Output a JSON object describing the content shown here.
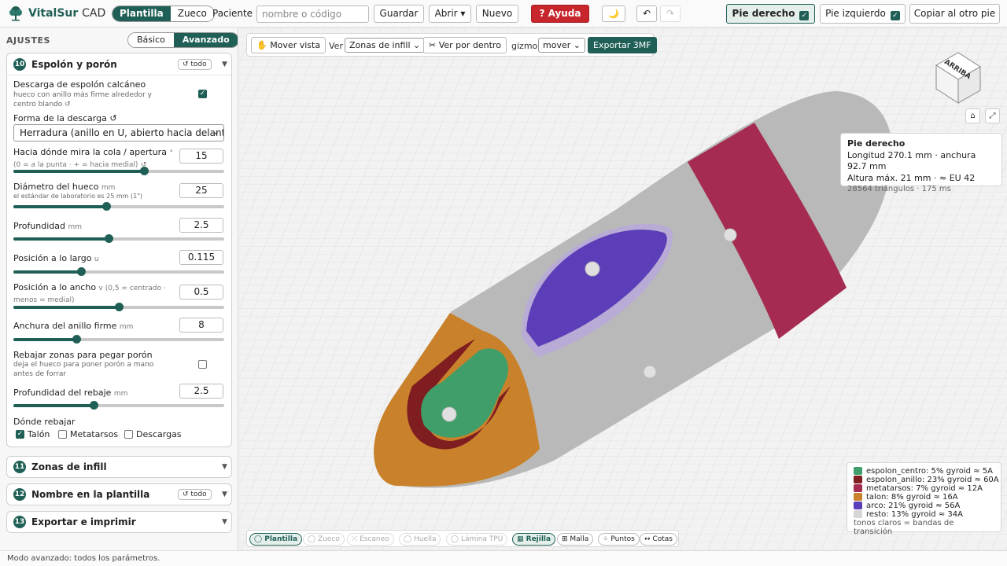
{
  "app": {
    "brand_strong": "VitalSur",
    "brand_light": "CAD"
  },
  "header": {
    "mode_tabs": [
      "Plantilla",
      "Zueco"
    ],
    "patient_label": "Paciente",
    "patient_placeholder": "nombre o código",
    "save": "Guardar",
    "open": "Abrir ▾",
    "new": "Nuevo",
    "help": "? Ayuda",
    "theme_icon": "🌙",
    "undo": "↶",
    "redo": "↷",
    "right_foot": "Pie derecho",
    "left_foot": "Pie izquierdo",
    "copy_other": "Copiar al otro pie",
    "right_foot_checked": true,
    "left_foot_checked": true
  },
  "sidebar": {
    "heading": "AJUSTES",
    "level_tabs": [
      "Básico",
      "Avanzado"
    ],
    "active_level": "Avanzado",
    "section10": {
      "number": "10",
      "title": "Espolón y porón",
      "reset": "↺ todo",
      "relief_label": "Descarga de espolón calcáneo",
      "relief_sub": "hueco con anillo más firme alrededor y centro blando",
      "relief_reset": "↺",
      "relief_checked": true,
      "shape_label": "Forma de la descarga",
      "shape_reset": "↺",
      "shape_value": "Herradura (anillo en U, abierto hacia delante)",
      "tail_label": "Hacia dónde mira la cola / apertura",
      "tail_unit": "°",
      "tail_hint": " (0 = a la punta · + = hacia medial)",
      "tail_reset": "↺",
      "tail_value": "15",
      "diameter_label": "Diámetro del hueco",
      "diameter_unit": "mm",
      "diameter_hint": "el estándar de laboratorio es 25 mm (1\")",
      "diameter_value": "25",
      "depth_label": "Profundidad",
      "depth_unit": "mm",
      "depth_value": "2.5",
      "poslong_label": "Posición a lo largo",
      "poslong_unit": "u",
      "poslong_value": "0.115",
      "poswide_label": "Posición a lo ancho",
      "poswide_unit": "v",
      "poswide_hint": " (0,5 = centrado · menos = medial)",
      "poswide_value": "0.5",
      "ring_label": "Anchura del anillo firme",
      "ring_unit": "mm",
      "ring_value": "8",
      "recess_label": "Rebajar zonas para pegar porón",
      "recess_sub": "deja el hueco para poner porón a mano antes de forrar",
      "recess_checked": false,
      "recess_depth_label": "Profundidad del rebaje",
      "recess_depth_unit": "mm",
      "recess_depth_value": "2.5",
      "where_label": "Dónde rebajar",
      "where_options": [
        {
          "label": "Talón",
          "checked": true
        },
        {
          "label": "Metatarsos",
          "checked": false
        },
        {
          "label": "Descargas",
          "checked": false
        }
      ],
      "slider_levels": {
        "tail": 0.62,
        "diameter": 0.44,
        "depth": 0.45,
        "poslong": 0.32,
        "poswide": 0.5,
        "ring": 0.3,
        "recess_depth": 0.38
      }
    },
    "section11": {
      "number": "11",
      "title": "Zonas de infill"
    },
    "section12": {
      "number": "12",
      "title": "Nombre en la plantilla",
      "reset": "↺ todo"
    },
    "section13": {
      "number": "13",
      "title": "Exportar e imprimir"
    }
  },
  "viewport": {
    "move_view": "✋ Mover vista",
    "view_label": "Ver",
    "view_select": "Zonas de infill",
    "see_inside": "✂ Ver por dentro",
    "gizmo_label": "gizmo",
    "gizmo_select": "mover",
    "export": "Exportar 3MF",
    "cube_label": "ARRIBA",
    "home_icon": "⌂",
    "expand_icon": "⤢",
    "info": {
      "title": "Pie derecho",
      "line1": "Longitud 270.1 mm · anchura 92.7 mm",
      "line2": "Altura máx. 21 mm · ≈ EU 42",
      "line3": "28564 triángulos · 175 ms"
    },
    "legend": [
      {
        "label": "espolon_centro: 5% gyroid ≈ 5A",
        "color": "#3f9e69"
      },
      {
        "label": "espolon_anillo: 23% gyroid ≈ 60A",
        "color": "#7f1d20"
      },
      {
        "label": "metatarsos: 7% gyroid ≈ 12A",
        "color": "#a52c50"
      },
      {
        "label": "talon: 8% gyroid ≈ 16A",
        "color": "#c9822b"
      },
      {
        "label": "arco: 21% gyroid ≈ 56A",
        "color": "#5c3fb8"
      },
      {
        "label": "resto: 13% gyroid ≈ 34A",
        "color": "#d6d6d6"
      }
    ],
    "legend_note": "tonos claros = bandas de transición",
    "bottom_tabs": [
      {
        "label": "Plantilla",
        "state": "on"
      },
      {
        "label": "Zueco",
        "state": "dis"
      },
      {
        "label": "Escaneo",
        "state": "dis"
      },
      {
        "label": "Huella",
        "state": "dis"
      },
      {
        "label": "Lámina TPU",
        "state": "dis"
      },
      {
        "label": "Rejilla",
        "state": "on"
      },
      {
        "label": "Malla",
        "state": ""
      },
      {
        "label": "Puntos",
        "state": ""
      },
      {
        "label": "Cotas",
        "state": ""
      }
    ]
  },
  "status": "Modo avanzado: todos los parámetros."
}
